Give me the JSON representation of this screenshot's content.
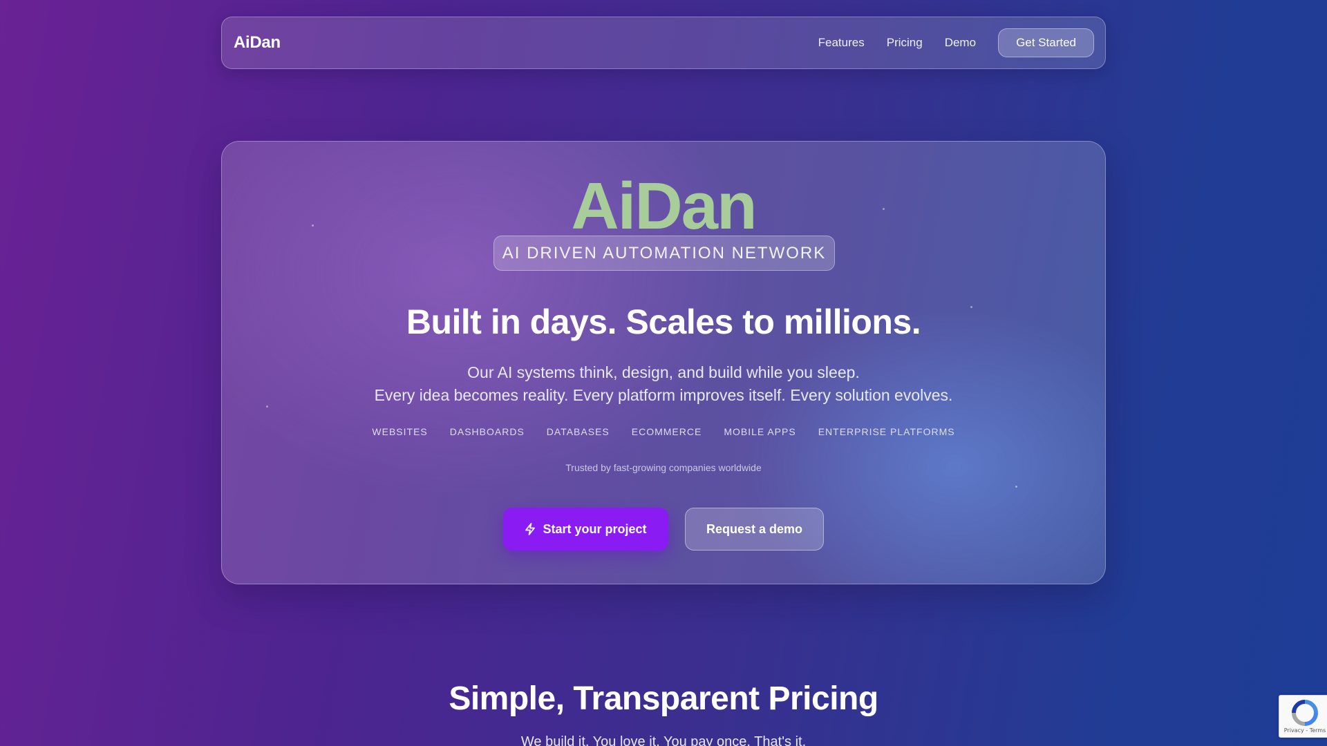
{
  "nav": {
    "brand": "AiDan",
    "links": [
      "Features",
      "Pricing",
      "Demo"
    ],
    "cta_label": "Get Started"
  },
  "hero": {
    "logo": "AiDan",
    "badge": "AI DRIVEN AUTOMATION NETWORK",
    "title": "Built in days. Scales to millions.",
    "subtitle_line1": "Our AI systems think, design, and build while you sleep.",
    "subtitle_line2": "Every idea becomes reality. Every platform improves itself. Every solution evolves.",
    "tags": [
      "WEBSITES",
      "DASHBOARDS",
      "DATABASES",
      "ECOMMERCE",
      "MOBILE APPS",
      "ENTERPRISE PLATFORMS"
    ],
    "trusted": "Trusted by fast-growing companies worldwide",
    "primary_button": "Start your project",
    "secondary_button": "Request a demo",
    "primary_icon": "lightning-icon"
  },
  "pricing": {
    "title": "Simple, Transparent Pricing",
    "subtitle": "We build it. You love it. You pay once. That's it."
  },
  "recaptcha": {
    "footer": "Privacy - Terms",
    "icon": "recaptcha-icon"
  },
  "colors": {
    "logo_green": "#a8cc9a",
    "primary_purple": "#8a1bf2"
  }
}
